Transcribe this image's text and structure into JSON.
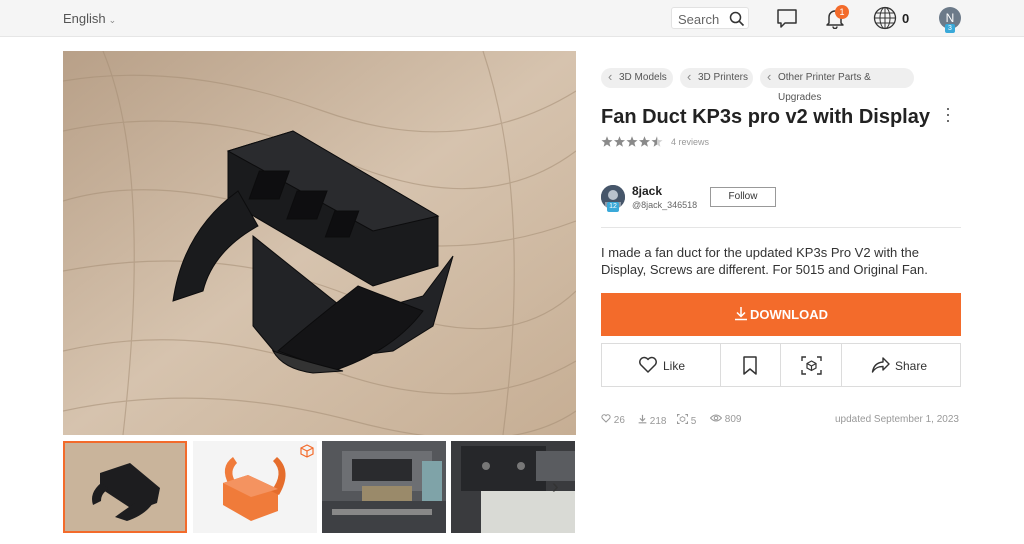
{
  "header": {
    "language": "English",
    "search_label": "Search",
    "notification_count": "1",
    "credits": "0",
    "user_initial": "N",
    "user_level": "3"
  },
  "breadcrumbs": [
    "3D Models",
    "3D Printers",
    "Other Printer Parts & Upgrades"
  ],
  "model": {
    "title": "Fan Duct KP3s pro v2 with Display",
    "rating": 4.5,
    "reviews": "4 reviews",
    "description": "I made a fan duct for the updated KP3s Pro V2 with the Display, Screws are different. For 5015 and Original Fan.",
    "download_label": "DOWNLOAD"
  },
  "author": {
    "name": "8jack",
    "handle": "@8jack_346518",
    "level": "12",
    "follow_label": "Follow"
  },
  "actions": {
    "like_label": "Like",
    "share_label": "Share"
  },
  "stats": {
    "likes": "26",
    "downloads": "218",
    "makes": "5",
    "views": "809",
    "updated": "updated September 1, 2023"
  },
  "colors": {
    "accent": "#f36b2b",
    "level_badge": "#3aa9d9"
  },
  "icons": [
    "chevron-down-icon",
    "search-icon",
    "chat-icon",
    "bell-icon",
    "credits-globe-icon",
    "more-vertical-icon",
    "heart-icon",
    "bookmark-icon",
    "ar-view-icon",
    "share-icon",
    "download-icon",
    "cube-3d-icon",
    "chevron-right-icon"
  ]
}
